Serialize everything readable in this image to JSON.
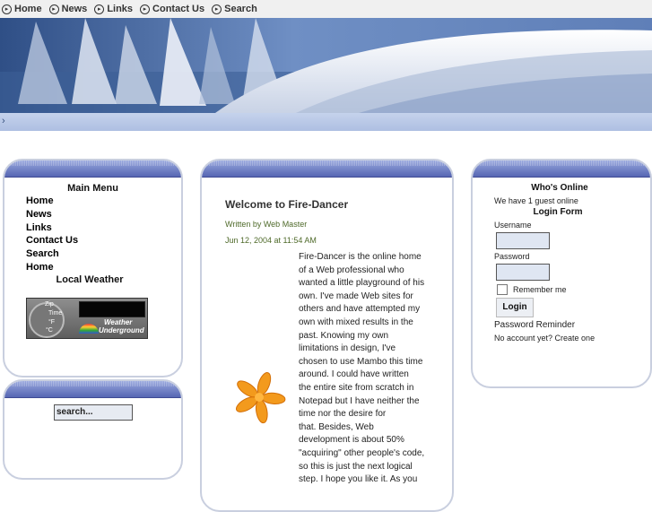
{
  "topnav": {
    "items": [
      "Home",
      "News",
      "Links",
      "Contact Us",
      "Search"
    ]
  },
  "left_menu": {
    "title": "Main Menu",
    "items": [
      "Home",
      "News",
      "Links",
      "Contact Us",
      "Search",
      "Home"
    ],
    "weather_title": "Local Weather",
    "weather_widget": {
      "zip_label": "Zip",
      "time_label": "Time",
      "f_label": "°F",
      "c_label": "°C",
      "brand_line1": "Weather",
      "brand_line2": "Underground"
    }
  },
  "search_box": {
    "value": "search..."
  },
  "article": {
    "title": "Welcome to Fire-Dancer",
    "author": "Written by Web Master",
    "date": "Jun 12, 2004 at 11:54 AM",
    "lines": [
      "Fire-Dancer is the online home",
      "of a Web professional who",
      "wanted a little playground of his",
      "own.  I've made Web sites for",
      "others and have attempted my",
      "own with mixed results in the",
      "past.  Knowing my own",
      "limitations in design, I've",
      "chosen to use Mambo this time",
      "around.  I could have written",
      "the entire site from scratch in",
      "Notepad but I have neither the",
      "time nor the desire for",
      "that.  Besides, Web",
      "development is about 50%",
      "\"acquiring\" other people's code,",
      "so this is just the next logical",
      "step.  I hope you like it.  As you"
    ]
  },
  "right": {
    "whos_online_title": "Who's Online",
    "guest_text": "We have 1 guest online",
    "login_title": "Login Form",
    "username_label": "Username",
    "password_label": "Password",
    "remember_label": "Remember me",
    "login_button": "Login",
    "reminder_link": "Password Reminder",
    "no_account_text": "No account yet? Create one"
  },
  "colors": {
    "cap_top": "#98a7dd",
    "cap_bottom": "#5666b3",
    "strip": "#c5d3ec",
    "article_meta": "#4f6a2a"
  }
}
